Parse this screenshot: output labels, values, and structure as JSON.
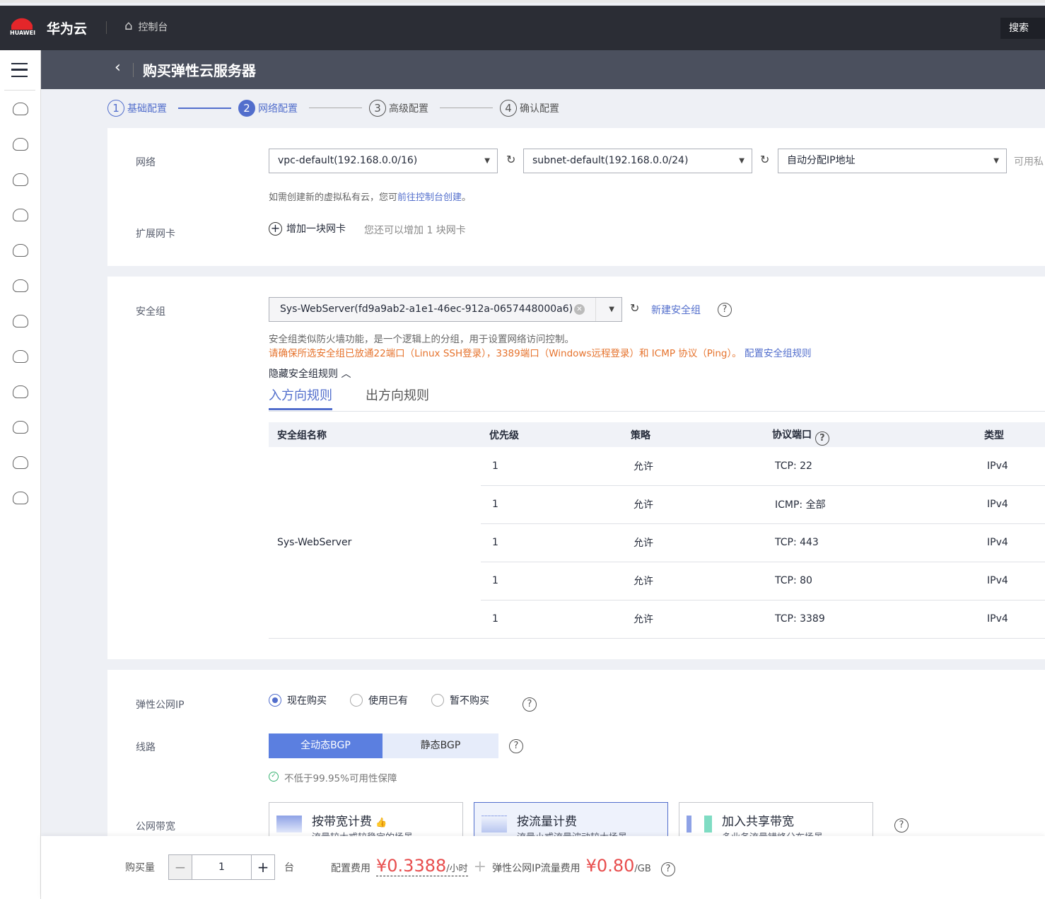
{
  "topbar": {
    "brand": "华为云",
    "logo_text": "HUAWEI",
    "console": "控制台",
    "search": "搜索"
  },
  "sidebar": {
    "icons": [
      "cloud-server-icon",
      "cloud-icon",
      "storage-icon",
      "network-icon",
      "device-icon",
      "cloud-icon-2",
      "cloud-upload-icon",
      "cloud-sync-icon",
      "ship-icon",
      "ip-icon",
      "cluster-icon",
      "globe-icon"
    ]
  },
  "header": {
    "title": "购买弹性云服务器"
  },
  "steps": [
    {
      "num": "1",
      "label": "基础配置"
    },
    {
      "num": "2",
      "label": "网络配置"
    },
    {
      "num": "3",
      "label": "高级配置"
    },
    {
      "num": "4",
      "label": "确认配置"
    }
  ],
  "network": {
    "label": "网络",
    "vpc": "vpc-default(192.168.0.0/16)",
    "subnet": "subnet-default(192.168.0.0/24)",
    "ip": "自动分配IP地址",
    "ip_hint": "可用私",
    "hint_prefix": "如需创建新的虚拟私有云，您可",
    "hint_link": "前往控制台创建",
    "hint_suffix": "。",
    "ext_label": "扩展网卡",
    "add_nic": "增加一块网卡",
    "nic_remaining": "您还可以增加 1 块网卡"
  },
  "security": {
    "label": "安全组",
    "value": "Sys-WebServer(fd9a9ab2-a1e1-46ec-912a-0657448000a6)",
    "new_link": "新建安全组",
    "desc": "安全组类似防火墙功能，是一个逻辑上的分组，用于设置网络访问控制。",
    "warning": "请确保所选安全组已放通22端口（Linux SSH登录），3389端口（Windows远程登录）和 ICMP 协议（Ping）。",
    "config_link": "配置安全组规则",
    "toggle": "隐藏安全组规则",
    "tabs": [
      "入方向规则",
      "出方向规则"
    ],
    "columns": [
      "安全组名称",
      "优先级",
      "策略",
      "协议端口",
      "类型"
    ],
    "group_name": "Sys-WebServer",
    "rules": [
      {
        "priority": "1",
        "policy": "允许",
        "port": "TCP: 22",
        "type": "IPv4"
      },
      {
        "priority": "1",
        "policy": "允许",
        "port": "ICMP: 全部",
        "type": "IPv4"
      },
      {
        "priority": "1",
        "policy": "允许",
        "port": "TCP: 443",
        "type": "IPv4"
      },
      {
        "priority": "1",
        "policy": "允许",
        "port": "TCP: 80",
        "type": "IPv4"
      },
      {
        "priority": "1",
        "policy": "允许",
        "port": "TCP: 3389",
        "type": "IPv4"
      }
    ]
  },
  "eip": {
    "label": "弹性公网IP",
    "options": [
      "现在购买",
      "使用已有",
      "暂不购买"
    ],
    "selected": 0,
    "line_label": "线路",
    "lines": [
      "全动态BGP",
      "静态BGP"
    ],
    "line_selected": 0,
    "sla": "不低于99.95%可用性保障",
    "bw_label": "公网带宽",
    "billing": [
      {
        "title": "按带宽计费",
        "sub": "流量较大或较稳定的场景"
      },
      {
        "title": "按流量计费",
        "sub": "流量小或流量波动较大场景"
      },
      {
        "title": "加入共享带宽",
        "sub": "多业务流量错峰分布场景"
      }
    ],
    "billing_selected": 1
  },
  "footer": {
    "qty_label": "购买量",
    "qty": "1",
    "unit": "台",
    "config_fee_label": "配置费用",
    "config_fee": "¥0.3388",
    "config_fee_unit": "/小时",
    "plus": "+",
    "eip_fee_label": "弹性公网IP流量费用",
    "eip_fee": "¥0.80",
    "eip_fee_unit": "/GB"
  },
  "colors": {
    "accent": "#526ecc",
    "price": "#e84d4d",
    "warning": "#e6732d",
    "topbar": "#2b2d35"
  }
}
